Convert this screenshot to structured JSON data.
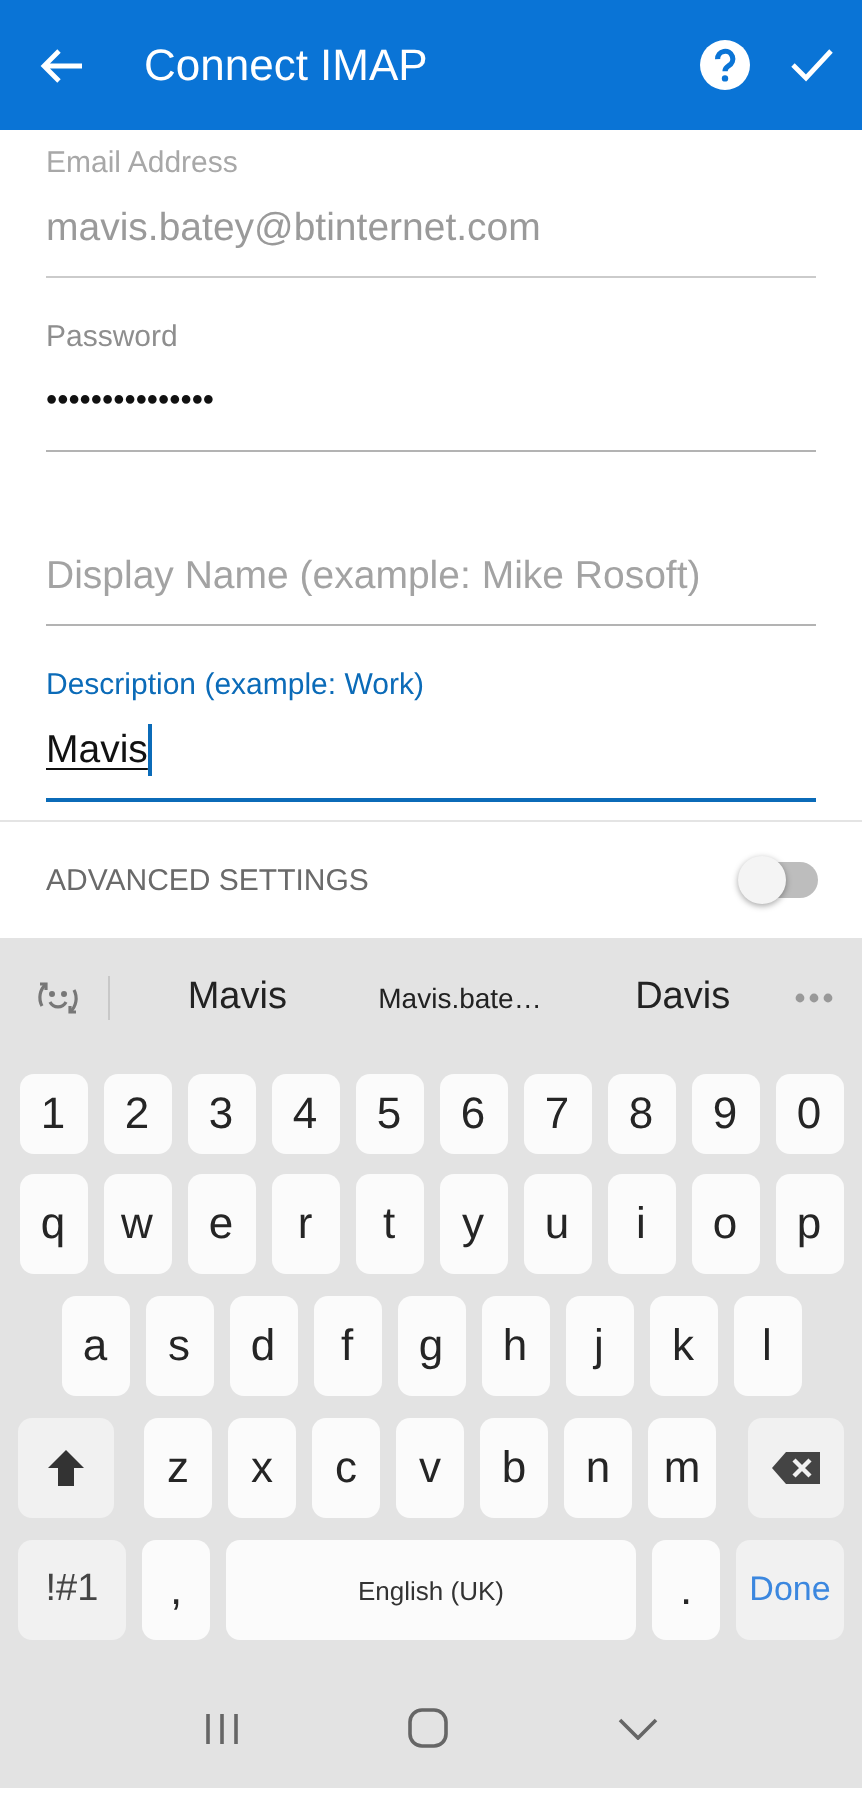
{
  "header": {
    "title": "Connect IMAP"
  },
  "fields": [
    {
      "kind": "text",
      "label": "Email Address",
      "value": "mavis.batey@btinternet.com",
      "focused": false,
      "disabled": true
    },
    {
      "kind": "password",
      "label": "Password",
      "value": "•••••••••••••••",
      "focused": false,
      "disabled": false
    },
    {
      "kind": "text",
      "placeholder": "Display Name (example: Mike Rosoft)",
      "focused": false,
      "disabled": false
    },
    {
      "kind": "text",
      "label": "Description (example: Work)",
      "value": "Mavis",
      "focused": true,
      "disabled": false
    }
  ],
  "advanced_settings": {
    "label": "ADVANCED SETTINGS",
    "on": false
  },
  "keyboard": {
    "suggestions": [
      "Mavis",
      "Mavis.bate…",
      "Davis"
    ],
    "rows": [
      {
        "keys": [
          {
            "kind": "char",
            "label": "1"
          },
          {
            "kind": "char",
            "label": "2"
          },
          {
            "kind": "char",
            "label": "3"
          },
          {
            "kind": "char",
            "label": "4"
          },
          {
            "kind": "char",
            "label": "5"
          },
          {
            "kind": "char",
            "label": "6"
          },
          {
            "kind": "char",
            "label": "7"
          },
          {
            "kind": "char",
            "label": "8"
          },
          {
            "kind": "char",
            "label": "9"
          },
          {
            "kind": "char",
            "label": "0"
          }
        ]
      },
      {
        "keys": [
          {
            "kind": "char",
            "label": "q"
          },
          {
            "kind": "char",
            "label": "w"
          },
          {
            "kind": "char",
            "label": "e"
          },
          {
            "kind": "char",
            "label": "r"
          },
          {
            "kind": "char",
            "label": "t"
          },
          {
            "kind": "char",
            "label": "y"
          },
          {
            "kind": "char",
            "label": "u"
          },
          {
            "kind": "char",
            "label": "i"
          },
          {
            "kind": "char",
            "label": "o"
          },
          {
            "kind": "char",
            "label": "p"
          }
        ]
      },
      {
        "keys": [
          {
            "kind": "char",
            "label": "a"
          },
          {
            "kind": "char",
            "label": "s"
          },
          {
            "kind": "char",
            "label": "d"
          },
          {
            "kind": "char",
            "label": "f"
          },
          {
            "kind": "char",
            "label": "g"
          },
          {
            "kind": "char",
            "label": "h"
          },
          {
            "kind": "char",
            "label": "j"
          },
          {
            "kind": "char",
            "label": "k"
          },
          {
            "kind": "char",
            "label": "l"
          }
        ]
      },
      {
        "keys": [
          {
            "kind": "shift"
          },
          {
            "kind": "char",
            "label": "z"
          },
          {
            "kind": "char",
            "label": "x"
          },
          {
            "kind": "char",
            "label": "c"
          },
          {
            "kind": "char",
            "label": "v"
          },
          {
            "kind": "char",
            "label": "b"
          },
          {
            "kind": "char",
            "label": "n"
          },
          {
            "kind": "char",
            "label": "m"
          },
          {
            "kind": "backspace"
          }
        ]
      },
      {
        "keys": [
          {
            "kind": "symbols",
            "label": "!#1"
          },
          {
            "kind": "char",
            "label": ","
          },
          {
            "kind": "space",
            "label": "English (UK)"
          },
          {
            "kind": "char",
            "label": "."
          },
          {
            "kind": "done",
            "label": "Done"
          }
        ]
      }
    ]
  }
}
